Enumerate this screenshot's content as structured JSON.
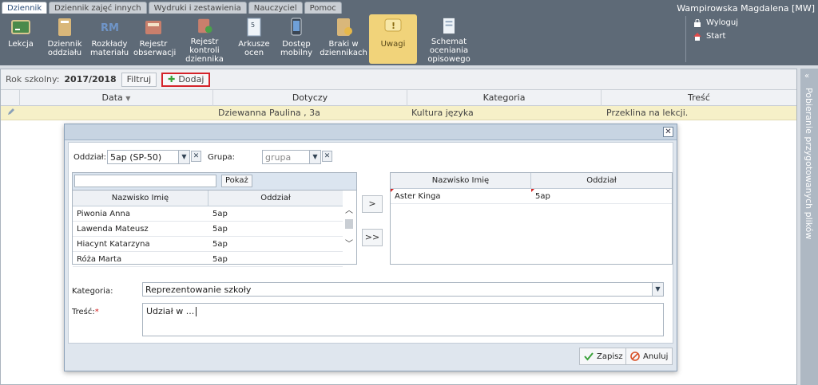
{
  "menu": {
    "tabs": [
      "Dziennik",
      "Dziennik zajęć innych",
      "Wydruki i zestawienia",
      "Nauczyciel",
      "Pomoc"
    ],
    "active_tab": "Dziennik"
  },
  "user": {
    "name": "Wampirowska Magdalena [MW]"
  },
  "links": {
    "logout": "Wyloguj",
    "start": "Start"
  },
  "toolbar": {
    "items": [
      {
        "label": "Lekcja",
        "icon": "lesson-icon"
      },
      {
        "label": "Dziennik oddziału",
        "icon": "class-journal-icon"
      },
      {
        "label": "Rozkłady materiału",
        "icon": "rm-icon"
      },
      {
        "label": "Rejestr obserwacji",
        "icon": "observation-register-icon"
      },
      {
        "label": "Rejestr kontroli dziennika",
        "icon": "control-register-icon"
      },
      {
        "label": "Arkusze ocen",
        "icon": "grade-sheets-icon"
      },
      {
        "label": "Dostęp mobilny",
        "icon": "mobile-icon"
      },
      {
        "label": "Braki w dziennikach",
        "icon": "missing-entries-icon"
      },
      {
        "label": "Uwagi",
        "icon": "remarks-icon"
      },
      {
        "label": "Schemat oceniania opisowego",
        "icon": "descriptive-grading-icon"
      }
    ],
    "active": "Uwagi"
  },
  "filterbar": {
    "year_label": "Rok szkolny:",
    "year_value": "2017/2018",
    "filter_label": "Filtruj",
    "add_label": "Dodaj"
  },
  "grid": {
    "columns": [
      "Data",
      "Dotyczy",
      "Kategoria",
      "Treść"
    ],
    "rows": [
      {
        "data": "",
        "dotyczy": "Dziewanna Paulina , 3a",
        "kategoria": "Kultura języka",
        "tresc": "Przeklina na lekcji."
      }
    ]
  },
  "side_panel": {
    "label": "Pobieranie przygotowanych plików"
  },
  "dialog": {
    "oddzial_label": "Oddział:",
    "oddzial_value": "5ap (SP-50)",
    "grupa_label": "Grupa:",
    "grupa_placeholder": "grupa",
    "search_placeholder": "",
    "pokaz_label": "Pokaż",
    "left_table": {
      "columns": [
        "Nazwisko Imię",
        "Oddział"
      ],
      "rows": [
        {
          "name": "Piwonia Anna",
          "oddzial": "5ap"
        },
        {
          "name": "Lawenda Mateusz",
          "oddzial": "5ap"
        },
        {
          "name": "Hiacynt Katarzyna",
          "oddzial": "5ap"
        },
        {
          "name": "Róża Marta",
          "oddzial": "5ap"
        }
      ]
    },
    "move_one": ">",
    "move_all": ">>",
    "right_table": {
      "columns": [
        "Nazwisko Imię",
        "Oddział"
      ],
      "rows": [
        {
          "name": "Aster Kinga",
          "oddzial": "5ap"
        }
      ]
    },
    "kategoria_label": "Kategoria:",
    "kategoria_value": "Reprezentowanie szkoły",
    "tresc_label": "Treść:",
    "required_mark": "*",
    "tresc_value": "Udział  w ...",
    "save_label": "Zapisz",
    "cancel_label": "Anuluj"
  },
  "colors": {
    "topbar": "#5e6a77",
    "active_tool": "#f1d37a",
    "highlight_border": "#d4232a",
    "selected_row": "#f6f0c8"
  }
}
